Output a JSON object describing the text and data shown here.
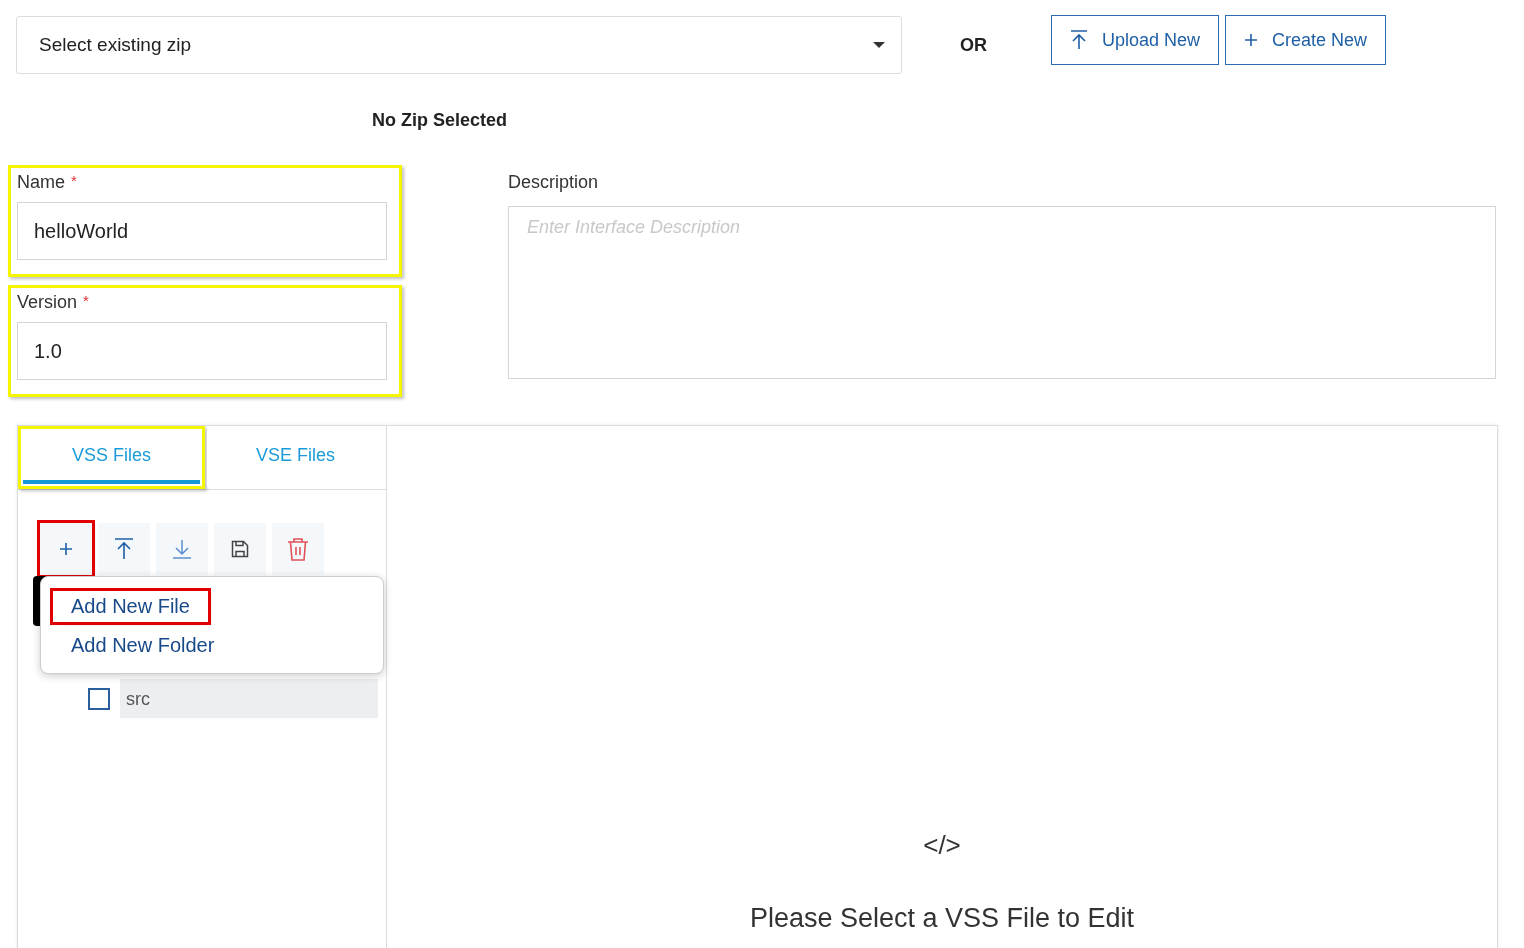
{
  "zip_select": {
    "placeholder": "Select existing zip"
  },
  "or_label": "OR",
  "actions": [
    {
      "kind": "upload",
      "label": "Upload New"
    },
    {
      "kind": "create",
      "label": "Create New"
    }
  ],
  "zip_status": "No Zip Selected",
  "fields": [
    {
      "label": "Name",
      "required_mark": "*",
      "value": "helloWorld",
      "highlighted": true
    },
    {
      "label": "Version",
      "required_mark": "*",
      "value": "1.0",
      "highlighted": true
    }
  ],
  "description": {
    "label": "Description",
    "placeholder": "Enter Interface Description"
  },
  "tabs": [
    {
      "label": "VSS Files",
      "selected": true,
      "highlighted": true
    },
    {
      "label": "VSE Files",
      "selected": false,
      "highlighted": false
    }
  ],
  "toolbar": [
    {
      "kind": "add",
      "highlighted": true
    },
    {
      "kind": "upload",
      "highlighted": false
    },
    {
      "kind": "download",
      "highlighted": false
    },
    {
      "kind": "save",
      "highlighted": false
    },
    {
      "kind": "delete",
      "highlighted": false
    }
  ],
  "menu": [
    {
      "label": "Add New File",
      "highlighted": true
    },
    {
      "label": "Add New Folder",
      "highlighted": false
    }
  ],
  "tree": [
    {
      "label": "src",
      "checked": false
    }
  ],
  "editor": {
    "icon_text": "</>",
    "message": "Please Select a VSS File to Edit"
  }
}
